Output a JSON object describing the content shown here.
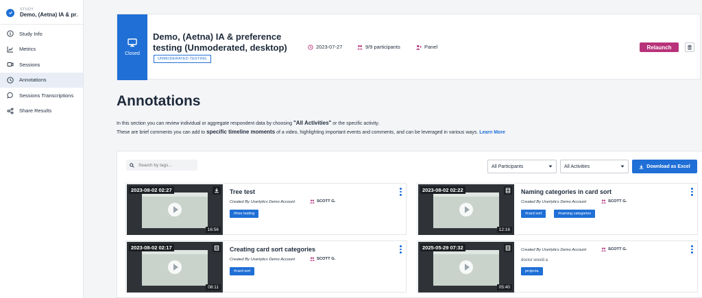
{
  "sidebar": {
    "study_label": "STUDY",
    "study_name": "Demo, (Aetna) IA & pref...",
    "items": [
      {
        "label": "Study Info",
        "icon": "info-icon"
      },
      {
        "label": "Metrics",
        "icon": "chart-icon"
      },
      {
        "label": "Sessions",
        "icon": "video-icon"
      },
      {
        "label": "Annotations",
        "icon": "clock-icon",
        "active": true
      },
      {
        "label": "Sessions Transcriptions",
        "icon": "chat-icon"
      },
      {
        "label": "Share Results",
        "icon": "share-icon"
      }
    ]
  },
  "header": {
    "status": "Closed",
    "title": "Demo, (Aetna) IA & preference testing (Unmoderated, desktop)",
    "badge": "UNMODERATED TESTING",
    "date": "2023-07-27",
    "participants": "9/9 participants",
    "panel": "Panel",
    "relaunch": "Relaunch"
  },
  "page": {
    "heading": "Annotations",
    "desc1_a": "In this section you can review individual or aggregate respondent data by choosing ",
    "desc1_b": "\"All Activities\"",
    "desc1_c": " or the specific activity.",
    "desc2_a": "These are brief comments you can add to ",
    "desc2_b": "specific timeline moments",
    "desc2_c": " of a video, highlighting important events and comments, and can be leveraged in various ways. ",
    "learn_more": "Learn More"
  },
  "toolbar": {
    "search_placeholder": "Search by tags...",
    "participants_select": "All Participants",
    "activities_select": "All Activities",
    "download": "Download as Excel"
  },
  "annotations": [
    {
      "timestamp": "2023-08-02 02:27",
      "duration": "16:56",
      "title": "Tree test",
      "created": "Created By Userlytics Demo Account",
      "user": "SCOTT G.",
      "tags": [
        "#tree testing"
      ]
    },
    {
      "timestamp": "2023-08-02 02:22",
      "duration": "12:16",
      "title": "Naming categories in card sort",
      "created": "Created By Userlytics Demo Account",
      "user": "SCOTT G.",
      "tags": [
        "#card sort",
        "#naming categories"
      ]
    },
    {
      "timestamp": "2023-08-02 02:17",
      "duration": "08:11",
      "title": "Creating card sort categories",
      "created": "Created By Userlytics Demo Account",
      "user": "SCOTT G.",
      "tags": [
        "#card sort"
      ]
    },
    {
      "timestamp": "2025-05-29 07:32",
      "duration": "05:40",
      "title": "",
      "created": "Created By Userlytics Demo Account",
      "user": "SCOTT G.",
      "note": "doctor would a",
      "tags": [
        "projecta"
      ]
    }
  ],
  "colors": {
    "accent": "#1f6fd6",
    "relaunch": "#b8327a",
    "text": "#1e2a3b"
  }
}
